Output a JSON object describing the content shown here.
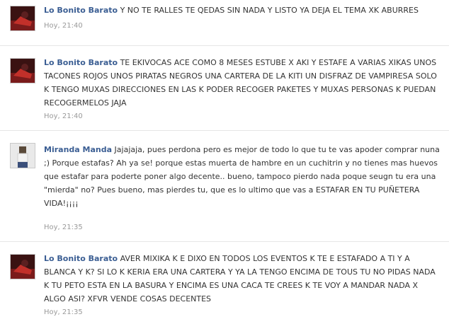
{
  "comments": [
    {
      "author": "Lo Bonito Barato",
      "text": "Y NO TE RALLES TE QEDAS SIN NADA Y LISTO YA DEJA EL TEMA XK ABURRES",
      "time": "Hoy, 21:40"
    },
    {
      "author": "Lo Bonito Barato",
      "text": "TE EKIVOCAS ACE COMO 8 MESES ESTUBE X AKI Y ESTAFE A VARIAS XIKAS UNOS TACONES ROJOS UNOS PIRATAS NEGROS UNA CARTERA DE LA KITI UN DISFRAZ DE VAMPIRESA SOLO K TENGO MUXAS DIRECCIONES EN LAS K PODER RECOGER PAKETES Y MUXAS PERSONAS K PUEDAN RECOGERMELOS JAJA",
      "time": "Hoy, 21:40"
    },
    {
      "author": "Miranda Manda",
      "text": "Jajajaja, pues perdona pero es mejor de todo lo que tu te vas apoder comprar nuna ;) Porque estafas? Ah ya se! porque estas muerta de hambre en un cuchitrin y no tienes mas huevos que estafar para poderte poner algo decente.. bueno, tampoco pierdo nada poque seugn tu era una \"mierda\" no? Pues bueno, mas pierdes tu, que es lo ultimo que vas a ESTAFAR EN TU PUÑETERA VIDA!¡¡¡¡",
      "time": "Hoy, 21:35"
    },
    {
      "author": "Lo Bonito Barato",
      "text": "AVER MIXIKA K E DIXO EN TODOS LOS EVENTOS K TE E ESTAFADO A TI Y A BLANCA Y K? SI LO K KERIA ERA UNA CARTERA Y YA LA TENGO ENCIMA DE TOUS TU NO PIDAS NADA K TU PETO ESTA EN LA BASURA Y ENCIMA ES UNA CACA TE CREES K TE VOY A MANDAR NADA X ALGO ASI? XFVR VENDE COSAS DECENTES",
      "time": "Hoy, 21:35"
    }
  ]
}
